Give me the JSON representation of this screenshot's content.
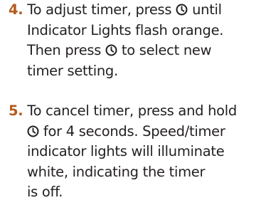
{
  "colors": {
    "step_number": "#b35a1f",
    "text": "#231f20",
    "background": "#ffffff"
  },
  "icon": "timer-clock-icon",
  "steps": [
    {
      "number": "4.",
      "lines": [
        [
          " To adjust timer, press ",
          "{icon}",
          " until"
        ],
        [
          "Indicator Lights flash orange."
        ],
        [
          "Then press ",
          "{icon}",
          " to select new"
        ],
        [
          "timer setting."
        ]
      ],
      "segments": {
        "a": " To adjust timer, press ",
        "b": " until",
        "c": "Indicator Lights flash orange.",
        "d": "Then press ",
        "e": " to select new",
        "f": "timer setting."
      }
    },
    {
      "number": "5.",
      "segments": {
        "a": " To cancel timer, press and hold",
        "b": " for 4 seconds. Speed/timer",
        "c": "indicator lights will illuminate",
        "d": "white, indicating the timer",
        "e": "is off."
      }
    }
  ]
}
